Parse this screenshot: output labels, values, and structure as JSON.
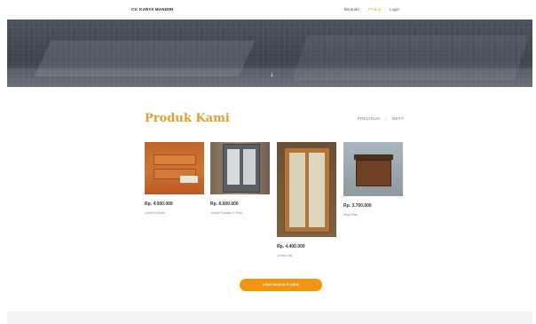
{
  "navbar": {
    "brand": "CV. KARYA MANDIRI",
    "links": [
      "Beranda",
      "Produk",
      "Login"
    ],
    "active_index": 1
  },
  "hero": {
    "scroll_icon": "arrow-down-icon"
  },
  "section": {
    "title": "Produk Kami",
    "pager_prev": "PREVIOUS",
    "pager_sep": "|",
    "pager_next": "NEXT"
  },
  "products": [
    {
      "price": "Rp. 4.000.000",
      "name": "Lemari Kitchen"
    },
    {
      "price": "Rp. 6.600.000",
      "name": "Lemari Pakaian 2 Pintu"
    },
    {
      "price": "Rp. 4.400.000",
      "name": "Lemari Jati"
    },
    {
      "price": "Rp. 3.700.000",
      "name": "Meja Rias"
    }
  ],
  "cta": {
    "label": "Lihat Semua Produk"
  },
  "colors": {
    "accent": "#ef9512",
    "title": "#e0a030",
    "nav_active": "#e0a81a"
  }
}
